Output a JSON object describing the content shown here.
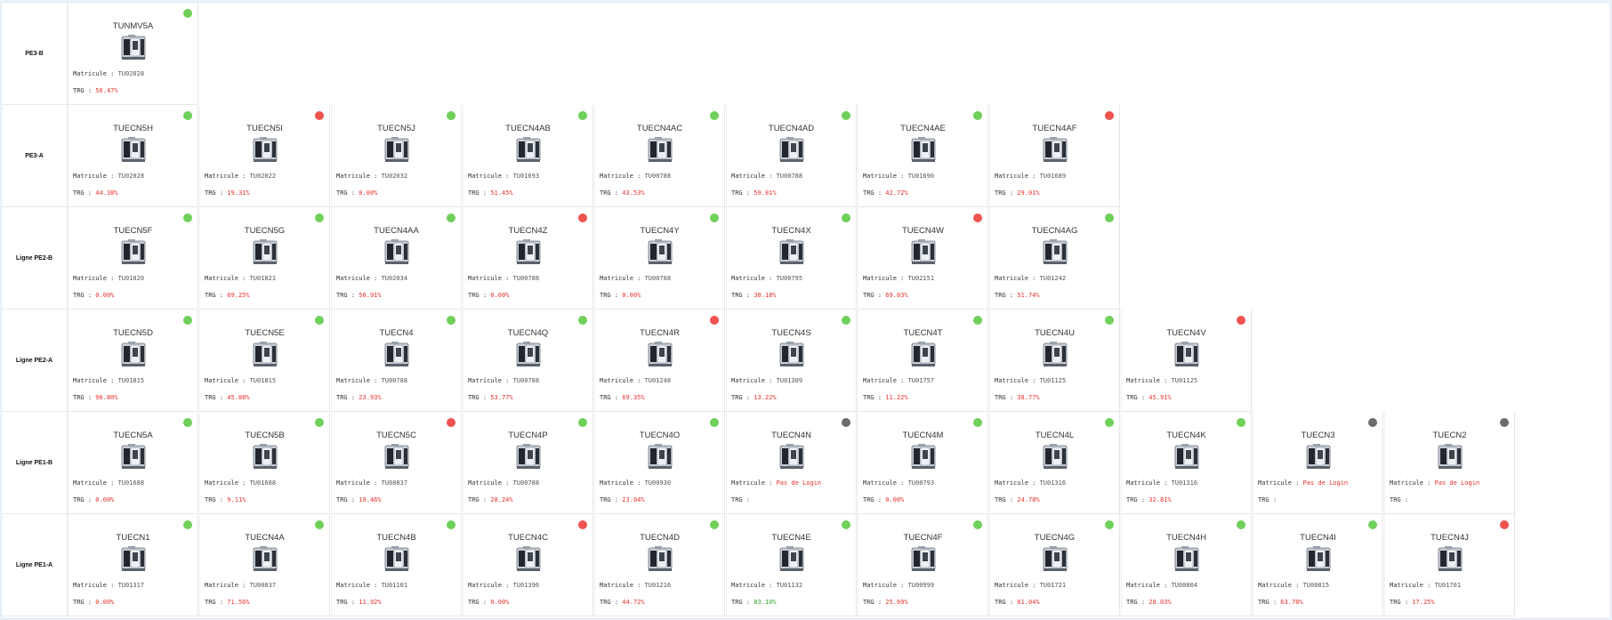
{
  "labels": {
    "matricule": "Matricule : ",
    "trg": "TRG : "
  },
  "colors": {
    "green": "#6fd05a",
    "red": "#ef5350",
    "gray": "#6b6b6b",
    "text_red": "#e8322d",
    "text_green": "#2dab2d"
  },
  "rows": [
    {
      "label": "PE3-B",
      "machines": [
        {
          "name": "TUNMV5A",
          "status": "green",
          "matricule": "TU02028",
          "trg": "56.47%",
          "trg_color": "red"
        }
      ]
    },
    {
      "label": "PE3-A",
      "machines": [
        {
          "name": "TUECN5H",
          "status": "green",
          "matricule": "TU02028",
          "trg": "44.38%",
          "trg_color": "red"
        },
        {
          "name": "TUECN5I",
          "status": "red",
          "matricule": "TU02022",
          "trg": "19.31%",
          "trg_color": "red"
        },
        {
          "name": "TUECN5J",
          "status": "green",
          "matricule": "TU02032",
          "trg": "0.00%",
          "trg_color": "red"
        },
        {
          "name": "TUECN4AB",
          "status": "green",
          "matricule": "TU01693",
          "trg": "51.45%",
          "trg_color": "red"
        },
        {
          "name": "TUECN4AC",
          "status": "green",
          "matricule": "TU00788",
          "trg": "43.53%",
          "trg_color": "red"
        },
        {
          "name": "TUECN4AD",
          "status": "green",
          "matricule": "TU00788",
          "trg": "59.81%",
          "trg_color": "red"
        },
        {
          "name": "TUECN4AE",
          "status": "green",
          "matricule": "TU01690",
          "trg": "42.72%",
          "trg_color": "red"
        },
        {
          "name": "TUECN4AF",
          "status": "red",
          "matricule": "TU01689",
          "trg": "29.01%",
          "trg_color": "red"
        }
      ]
    },
    {
      "label": "Ligne PE2-B",
      "machines": [
        {
          "name": "TUECN5F",
          "status": "green",
          "matricule": "TU01820",
          "trg": "0.00%",
          "trg_color": "red"
        },
        {
          "name": "TUECN5G",
          "status": "green",
          "matricule": "TU01821",
          "trg": "69.25%",
          "trg_color": "red"
        },
        {
          "name": "TUECN4AA",
          "status": "green",
          "matricule": "TU02034",
          "trg": "50.91%",
          "trg_color": "red"
        },
        {
          "name": "TUECN4Z",
          "status": "red",
          "matricule": "TU00788",
          "trg": "0.00%",
          "trg_color": "red"
        },
        {
          "name": "TUECN4Y",
          "status": "green",
          "matricule": "TU00788",
          "trg": "0.00%",
          "trg_color": "red"
        },
        {
          "name": "TUECN4X",
          "status": "green",
          "matricule": "TU00795",
          "trg": "38.18%",
          "trg_color": "red"
        },
        {
          "name": "TUECN4W",
          "status": "red",
          "matricule": "TU02151",
          "trg": "69.03%",
          "trg_color": "red"
        },
        {
          "name": "TUECN4AG",
          "status": "green",
          "matricule": "TU01242",
          "trg": "51.74%",
          "trg_color": "red"
        }
      ]
    },
    {
      "label": "Ligne PE2-A",
      "machines": [
        {
          "name": "TUECN5D",
          "status": "green",
          "matricule": "TU01815",
          "trg": "90.80%",
          "trg_color": "red"
        },
        {
          "name": "TUECN5E",
          "status": "green",
          "matricule": "TU01815",
          "trg": "45.88%",
          "trg_color": "red"
        },
        {
          "name": "TUECN4",
          "status": "green",
          "matricule": "TU00788",
          "trg": "23.93%",
          "trg_color": "red"
        },
        {
          "name": "TUECN4Q",
          "status": "green",
          "matricule": "TU00788",
          "trg": "53.77%",
          "trg_color": "red"
        },
        {
          "name": "TUECN4R",
          "status": "red",
          "matricule": "TU01248",
          "trg": "69.35%",
          "trg_color": "red"
        },
        {
          "name": "TUECN4S",
          "status": "green",
          "matricule": "TU01309",
          "trg": "13.22%",
          "trg_color": "red"
        },
        {
          "name": "TUECN4T",
          "status": "green",
          "matricule": "TU01757",
          "trg": "11.22%",
          "trg_color": "red"
        },
        {
          "name": "TUECN4U",
          "status": "green",
          "matricule": "TU01125",
          "trg": "38.77%",
          "trg_color": "red"
        },
        {
          "name": "TUECN4V",
          "status": "red",
          "matricule": "TU01125",
          "trg": "45.91%",
          "trg_color": "red"
        }
      ]
    },
    {
      "label": "Ligne PE1-B",
      "machines": [
        {
          "name": "TUECN5A",
          "status": "green",
          "matricule": "TU01688",
          "trg": "0.00%",
          "trg_color": "red"
        },
        {
          "name": "TUECN5B",
          "status": "green",
          "matricule": "TU01688",
          "trg": "9.11%",
          "trg_color": "red"
        },
        {
          "name": "TUECN5C",
          "status": "red",
          "matricule": "TU00837",
          "trg": "19.46%",
          "trg_color": "red"
        },
        {
          "name": "TUECN4P",
          "status": "green",
          "matricule": "TU00788",
          "trg": "28.24%",
          "trg_color": "red"
        },
        {
          "name": "TUECN4O",
          "status": "green",
          "matricule": "TU00930",
          "trg": "23.04%",
          "trg_color": "red"
        },
        {
          "name": "TUECN4N",
          "status": "gray",
          "matricule": "Pas de Login",
          "matricule_color": "red",
          "trg": "",
          "trg_color": "red"
        },
        {
          "name": "TUECN4M",
          "status": "green",
          "matricule": "TU00793",
          "trg": "0.00%",
          "trg_color": "red"
        },
        {
          "name": "TUECN4L",
          "status": "green",
          "matricule": "TU01316",
          "trg": "24.78%",
          "trg_color": "red"
        },
        {
          "name": "TUECN4K",
          "status": "green",
          "matricule": "TU01316",
          "trg": "32.81%",
          "trg_color": "red"
        },
        {
          "name": "TUECN3",
          "status": "gray",
          "matricule": "Pas de Login",
          "matricule_color": "red",
          "trg": "",
          "trg_color": "red"
        },
        {
          "name": "TUECN2",
          "status": "gray",
          "matricule": "Pas de Login",
          "matricule_color": "red",
          "trg": "",
          "trg_color": "red"
        }
      ]
    },
    {
      "label": "Ligne PE1-A",
      "machines": [
        {
          "name": "TUECN1",
          "status": "green",
          "matricule": "TU01317",
          "trg": "0.00%",
          "trg_color": "red"
        },
        {
          "name": "TUECN4A",
          "status": "green",
          "matricule": "TU00837",
          "trg": "71.56%",
          "trg_color": "red"
        },
        {
          "name": "TUECN4B",
          "status": "green",
          "matricule": "TU01101",
          "trg": "11.92%",
          "trg_color": "red"
        },
        {
          "name": "TUECN4C",
          "status": "red",
          "matricule": "TU01396",
          "trg": "0.00%",
          "trg_color": "red"
        },
        {
          "name": "TUECN4D",
          "status": "green",
          "matricule": "TU01216",
          "trg": "44.72%",
          "trg_color": "red"
        },
        {
          "name": "TUECN4E",
          "status": "green",
          "matricule": "TU01132",
          "trg": "83.10%",
          "trg_color": "green"
        },
        {
          "name": "TUECN4F",
          "status": "green",
          "matricule": "TU00999",
          "trg": "25.69%",
          "trg_color": "red"
        },
        {
          "name": "TUECN4G",
          "status": "green",
          "matricule": "TU01721",
          "trg": "61.04%",
          "trg_color": "red"
        },
        {
          "name": "TUECN4H",
          "status": "green",
          "matricule": "TU00804",
          "trg": "28.03%",
          "trg_color": "red"
        },
        {
          "name": "TUECN4I",
          "status": "green",
          "matricule": "TU00815",
          "trg": "63.78%",
          "trg_color": "red"
        },
        {
          "name": "TUECN4J",
          "status": "red",
          "matricule": "TU01701",
          "trg": "17.25%",
          "trg_color": "red"
        }
      ]
    }
  ]
}
